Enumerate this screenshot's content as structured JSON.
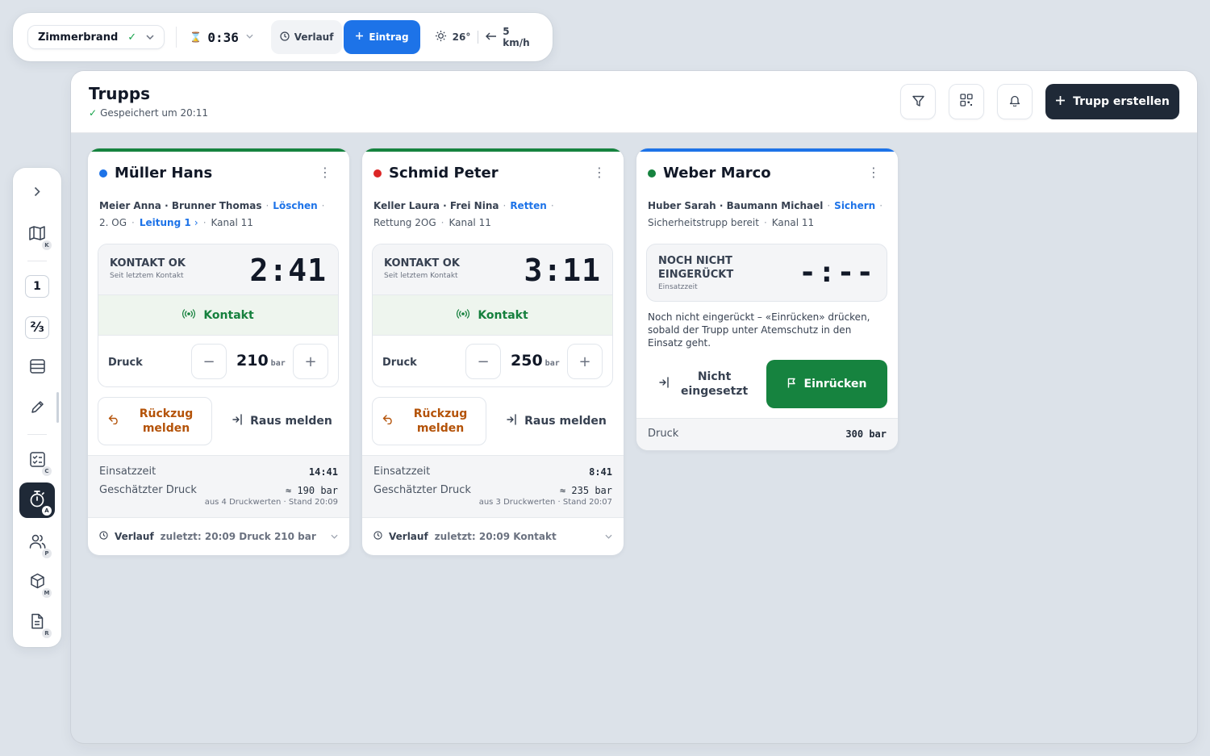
{
  "colors": {
    "accent_blue": "#1d73e8",
    "dark": "#1f2937",
    "green": "#16833f",
    "green_text": "#15803d",
    "red_dot": "#dc2626",
    "orange": "#b45309"
  },
  "topbar": {
    "incident": "Zimmerbrand",
    "timer": "0:36",
    "verlauf_label": "Verlauf",
    "eintrag_label": "Eintrag",
    "temperature": "26°",
    "wind": "5 km/h"
  },
  "sidebar": {
    "items": [
      {
        "icon": "chevron-right-icon"
      },
      {
        "icon": "map-icon",
        "badge": "K"
      },
      {
        "icon": "one-box",
        "label": "1"
      },
      {
        "icon": "fraction-box",
        "label": "⅔"
      },
      {
        "icon": "table-icon"
      },
      {
        "icon": "pencil-icon"
      },
      {
        "icon": "checklist-icon",
        "badge": "C"
      },
      {
        "icon": "stopwatch-icon",
        "badge": "A",
        "active": true
      },
      {
        "icon": "users-icon",
        "badge": "P"
      },
      {
        "icon": "cube-icon",
        "badge": "M"
      },
      {
        "icon": "document-icon",
        "badge": "R"
      }
    ]
  },
  "header": {
    "title": "Trupps",
    "saved": "Gespeichert um 20:11",
    "create_label": "Trupp erstellen"
  },
  "labels": {
    "press": "Druck",
    "bar": "bar",
    "kontakt": "Kontakt",
    "retreat": "Rückzug melden",
    "out": "Raus melden",
    "einsatzzeit": "Einsatzzeit",
    "est_press": "Geschätzter Druck",
    "history": "Verlauf"
  },
  "cards": [
    {
      "name": "Müller Hans",
      "members": "Meier Anna · Brunner Thomas",
      "task": "Löschen",
      "location": "2. OG",
      "line": "Leitung 1",
      "channel": "Kanal 11",
      "status": "KONTAKT OK",
      "status_sub": "Seit letztem Kontakt",
      "time": "2:41",
      "pressure": "210",
      "einsatzzeit": "14:41",
      "est_pressure": "≈ 190 bar",
      "est_note": "aus 4 Druckwerten · Stand 20:09",
      "history": "zuletzt: 20:09 Druck 210 bar"
    },
    {
      "name": "Schmid Peter",
      "members": "Keller Laura · Frei Nina",
      "task": "Retten",
      "location": "Rettung 2OG",
      "channel": "Kanal 11",
      "status": "KONTAKT OK",
      "status_sub": "Seit letztem Kontakt",
      "time": "3:11",
      "pressure": "250",
      "einsatzzeit": "8:41",
      "est_pressure": "≈ 235 bar",
      "est_note": "aus 3 Druckwerten · Stand 20:07",
      "history": "zuletzt: 20:09 Kontakt"
    },
    {
      "name": "Weber Marco",
      "members": "Huber Sarah · Baumann Michael",
      "task": "Sichern",
      "location": "Sicherheitstrupp bereit",
      "channel": "Kanal 11",
      "status_line1": "NOCH NICHT",
      "status_line2": "EINGERÜCKT",
      "status_sub": "Einsatzzeit",
      "time": "-:--",
      "hint": "Noch nicht eingerückt – «Einrücken» drücken, sobald der Trupp unter Atemschutz in den Einsatz geht.",
      "notset_line1": "Nicht",
      "notset_line2": "eingesetzt",
      "engage_label": "Einrücken",
      "pressure_label": "Druck",
      "pressure": "300 bar"
    }
  ]
}
